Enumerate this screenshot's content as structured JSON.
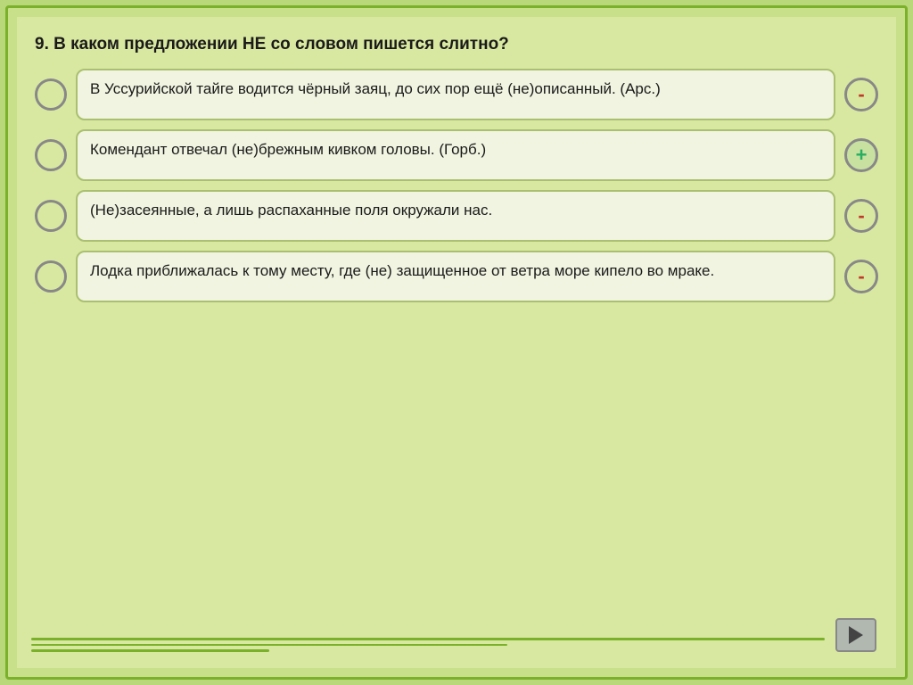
{
  "question": "9.  В  каком  предложении  НЕ  со  словом  пишется  слитно?",
  "answers": [
    {
      "id": 1,
      "text": "В Уссурийской тайге водится чёрный заяц, до сих пор ещё (не)описанный. (Арс.)",
      "sign": "-",
      "sign_type": "minus"
    },
    {
      "id": 2,
      "text": "Комендант отвечал (не)брежным кивком головы. (Горб.)",
      "sign": "+",
      "sign_type": "plus"
    },
    {
      "id": 3,
      "text": "(Не)засеянные,  а  лишь  распаханные  поля окружали нас.",
      "sign": "-",
      "sign_type": "minus"
    },
    {
      "id": 4,
      "text": "Лодка  приближалась  к  тому  месту,  где  (не) защищенное от ветра море кипело во мраке.",
      "sign": "-",
      "sign_type": "minus"
    }
  ]
}
